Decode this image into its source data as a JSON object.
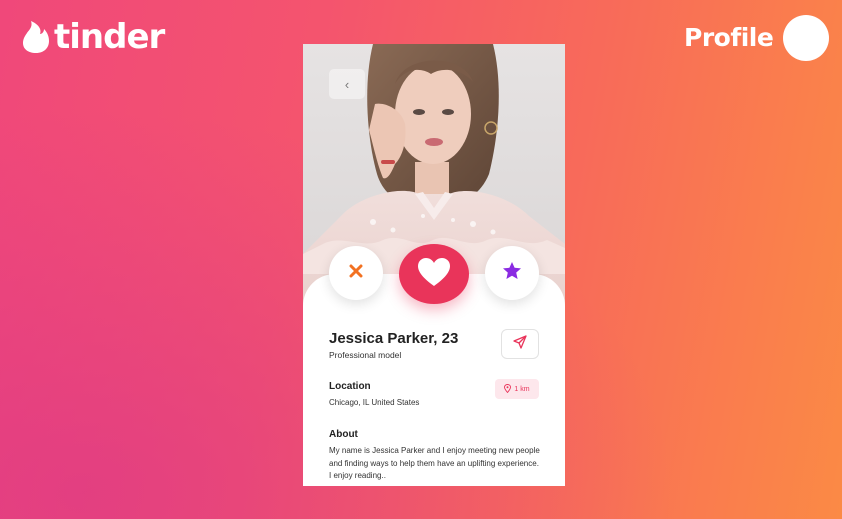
{
  "header": {
    "brand": "tinder",
    "nav_label": "Profile"
  },
  "icons": {
    "logo": "flame-icon",
    "back": "chevron-left-icon",
    "dislike": "close-icon",
    "like": "heart-icon",
    "super_like": "star-icon",
    "send": "send-icon",
    "location": "location-pin-icon"
  },
  "profile": {
    "back_label": "‹",
    "name": "Jessica Parker, 23",
    "occupation": "Professional model",
    "location_title": "Location",
    "location_value": "Chicago, IL United States",
    "distance": "1 km",
    "about_title": "About",
    "about_text": "My name is Jessica Parker and I enjoy meeting new people and finding ways to help them have an uplifting experience. I enjoy reading.."
  },
  "colors": {
    "accent": "#e9345a",
    "dislike": "#f27121",
    "super_like": "#8a2be2",
    "badge_bg": "#fde7ec"
  }
}
